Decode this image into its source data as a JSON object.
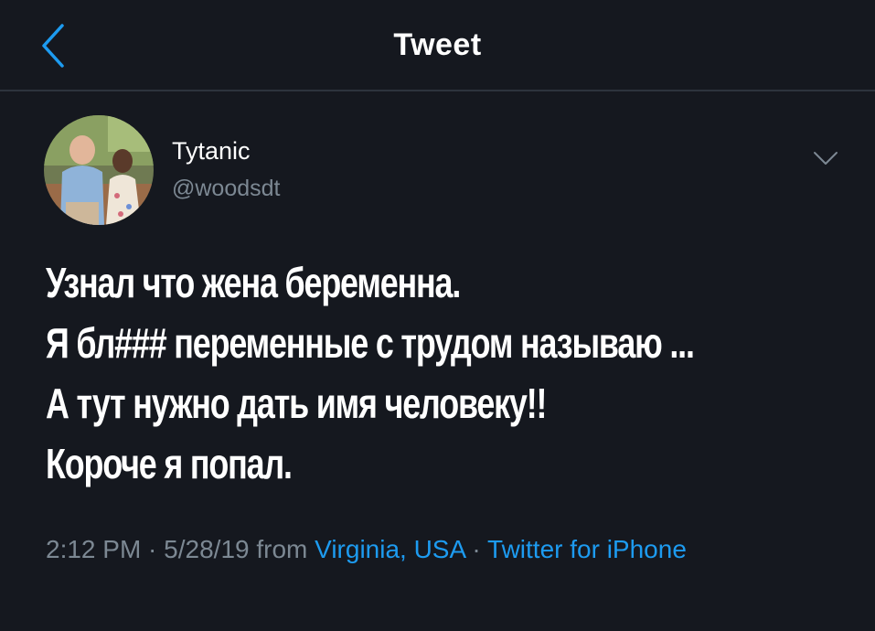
{
  "header": {
    "title": "Tweet",
    "back_icon": "chevron-left-icon"
  },
  "colors": {
    "background": "#15181f",
    "accent": "#1d9bf0",
    "secondary_text": "#7c8893",
    "divider": "#2d333d"
  },
  "author": {
    "display_name": "Tytanic",
    "handle": "@woodsdt",
    "avatar_icon": "avatar-photo",
    "menu_icon": "chevron-down-icon"
  },
  "tweet": {
    "lines": [
      "Узнал что жена беременна.",
      "Я бл### переменные с трудом называю ...",
      "А тут нужно дать имя человеку!!",
      "Короче я попал."
    ]
  },
  "meta": {
    "time": "2:12 PM",
    "sep1": " · ",
    "date": "5/28/19",
    "from_label": " from ",
    "location": "Virginia, USA",
    "sep2": " · ",
    "source": "Twitter for iPhone"
  }
}
